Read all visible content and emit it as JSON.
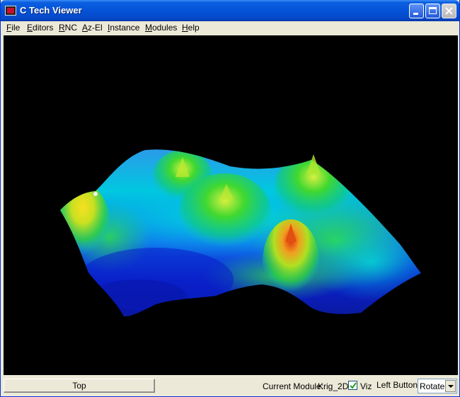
{
  "window": {
    "title": "C Tech Viewer"
  },
  "menu": {
    "items": [
      {
        "hotkey": "F",
        "rest": "ile"
      },
      {
        "hotkey": "E",
        "rest": "ditors"
      },
      {
        "hotkey": "R",
        "rest": "NC"
      },
      {
        "hotkey": "A",
        "rest": "z-El"
      },
      {
        "hotkey": "I",
        "rest": "nstance"
      },
      {
        "hotkey": "M",
        "rest": "odules"
      },
      {
        "hotkey": "H",
        "rest": "elp"
      }
    ]
  },
  "viewport": {
    "background": "#000000",
    "surface_colors": {
      "low": "#0a1fc8",
      "mid_low": "#00c8e8",
      "mid": "#30d838",
      "mid_high": "#e8e020",
      "high": "#e03010"
    }
  },
  "status": {
    "view_button": "Top",
    "current_module_label": "Current Module:",
    "current_module_value": "Krig_2D",
    "viz_checked": true,
    "viz_label": "Viz",
    "left_button_label": "Left Button",
    "left_button_value": "Rotate"
  },
  "icons": {
    "app": "app-icon",
    "minimize": "minimize-icon",
    "maximize": "maximize-icon",
    "close": "close-icon",
    "checkbox": "check-icon",
    "dropdown": "chevron-down-icon"
  }
}
